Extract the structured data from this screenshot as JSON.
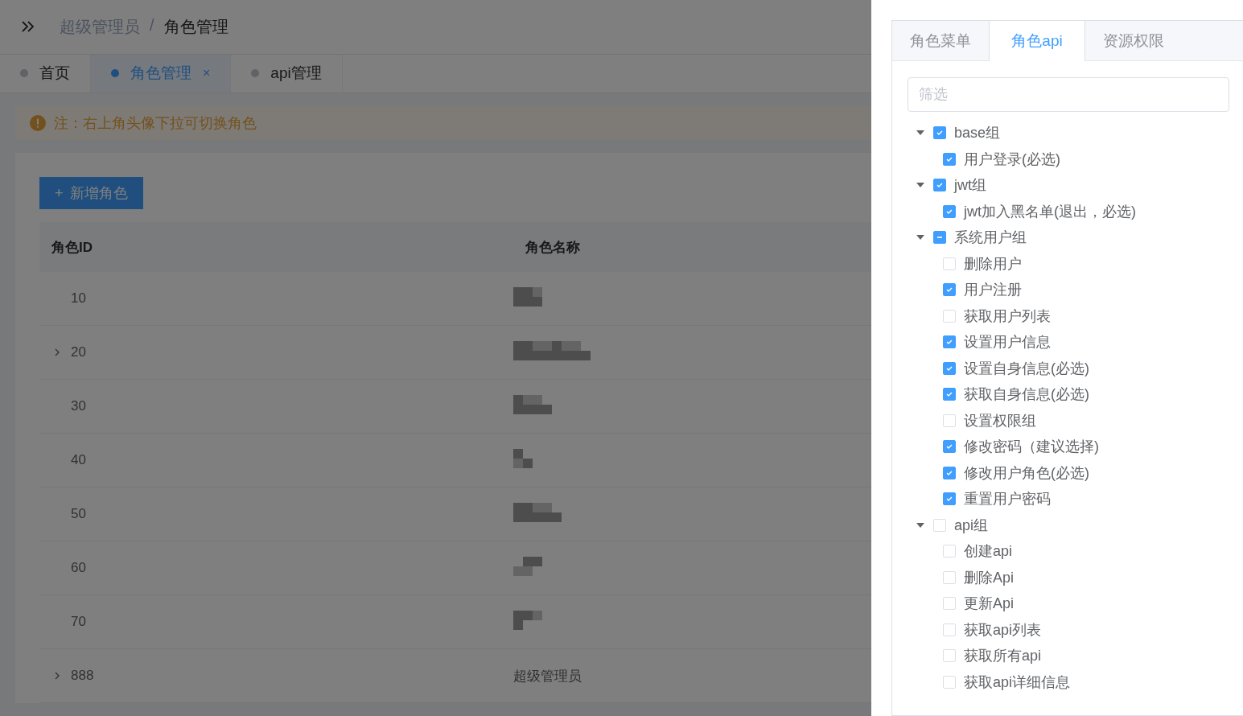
{
  "breadcrumb": [
    {
      "label": "超级管理员",
      "current": false
    },
    {
      "label": "/",
      "current": false
    },
    {
      "label": "角色管理",
      "current": true
    }
  ],
  "tabs": [
    {
      "label": "首页",
      "selected": false,
      "closable": false
    },
    {
      "label": "角色管理",
      "selected": true,
      "closable": true,
      "close": "×"
    },
    {
      "label": "api管理",
      "selected": false,
      "closable": false
    }
  ],
  "alert": {
    "text": "注：右上角头像下拉可切换角色"
  },
  "add_button": {
    "icon": "+",
    "label": "新增角色"
  },
  "table": {
    "columns": [
      "角色ID",
      "角色名称"
    ],
    "rows": [
      {
        "id": "10",
        "expandable": false,
        "redacted": true
      },
      {
        "id": "20",
        "expandable": true,
        "redacted": true
      },
      {
        "id": "30",
        "expandable": false,
        "redacted": true
      },
      {
        "id": "40",
        "expandable": false,
        "redacted": true
      },
      {
        "id": "50",
        "expandable": false,
        "redacted": true
      },
      {
        "id": "60",
        "expandable": false,
        "redacted": true
      },
      {
        "id": "70",
        "expandable": false,
        "redacted": true
      },
      {
        "id": "888",
        "expandable": true,
        "redacted": false,
        "name": "超级管理员"
      }
    ]
  },
  "drawer": {
    "tabs": [
      {
        "label": "角色菜单",
        "selected": false
      },
      {
        "label": "角色api",
        "selected": true
      },
      {
        "label": "资源权限",
        "selected": false
      }
    ],
    "filter": {
      "placeholder": "筛选"
    },
    "tree": [
      {
        "label": "base组",
        "checked": true,
        "indeterminate": false,
        "expanded": true,
        "children": [
          {
            "label": "用户登录(必选)",
            "checked": true
          }
        ]
      },
      {
        "label": "jwt组",
        "checked": true,
        "indeterminate": false,
        "expanded": true,
        "children": [
          {
            "label": "jwt加入黑名单(退出，必选)",
            "checked": true
          }
        ]
      },
      {
        "label": "系统用户组",
        "checked": false,
        "indeterminate": true,
        "expanded": true,
        "children": [
          {
            "label": "删除用户",
            "checked": false
          },
          {
            "label": "用户注册",
            "checked": true
          },
          {
            "label": "获取用户列表",
            "checked": false
          },
          {
            "label": "设置用户信息",
            "checked": true
          },
          {
            "label": "设置自身信息(必选)",
            "checked": true
          },
          {
            "label": "获取自身信息(必选)",
            "checked": true
          },
          {
            "label": "设置权限组",
            "checked": false
          },
          {
            "label": "修改密码（建议选择)",
            "checked": true
          },
          {
            "label": "修改用户角色(必选)",
            "checked": true
          },
          {
            "label": "重置用户密码",
            "checked": true
          }
        ]
      },
      {
        "label": "api组",
        "checked": false,
        "indeterminate": false,
        "expanded": true,
        "children": [
          {
            "label": "创建api",
            "checked": false
          },
          {
            "label": "删除Api",
            "checked": false
          },
          {
            "label": "更新Api",
            "checked": false
          },
          {
            "label": "获取api列表",
            "checked": false
          },
          {
            "label": "获取所有api",
            "checked": false
          },
          {
            "label": "获取api详细信息",
            "checked": false
          }
        ]
      }
    ]
  }
}
